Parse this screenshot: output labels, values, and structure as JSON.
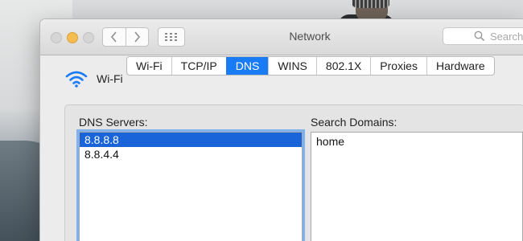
{
  "window": {
    "title": "Network",
    "search_placeholder": "Search"
  },
  "interface": {
    "name": "Wi-Fi"
  },
  "tabs": [
    {
      "label": "Wi-Fi",
      "active": false
    },
    {
      "label": "TCP/IP",
      "active": false
    },
    {
      "label": "DNS",
      "active": true
    },
    {
      "label": "WINS",
      "active": false
    },
    {
      "label": "802.1X",
      "active": false
    },
    {
      "label": "Proxies",
      "active": false
    },
    {
      "label": "Hardware",
      "active": false
    }
  ],
  "dns_servers": {
    "label": "DNS Servers:",
    "items": [
      "8.8.8.8",
      "8.8.4.4"
    ],
    "selected_index": 0
  },
  "search_domains": {
    "label": "Search Domains:",
    "items": [
      "home"
    ]
  },
  "colors": {
    "accent": "#1a7cf4",
    "selection": "#1864d8",
    "minimize": "#f5bd4f"
  }
}
